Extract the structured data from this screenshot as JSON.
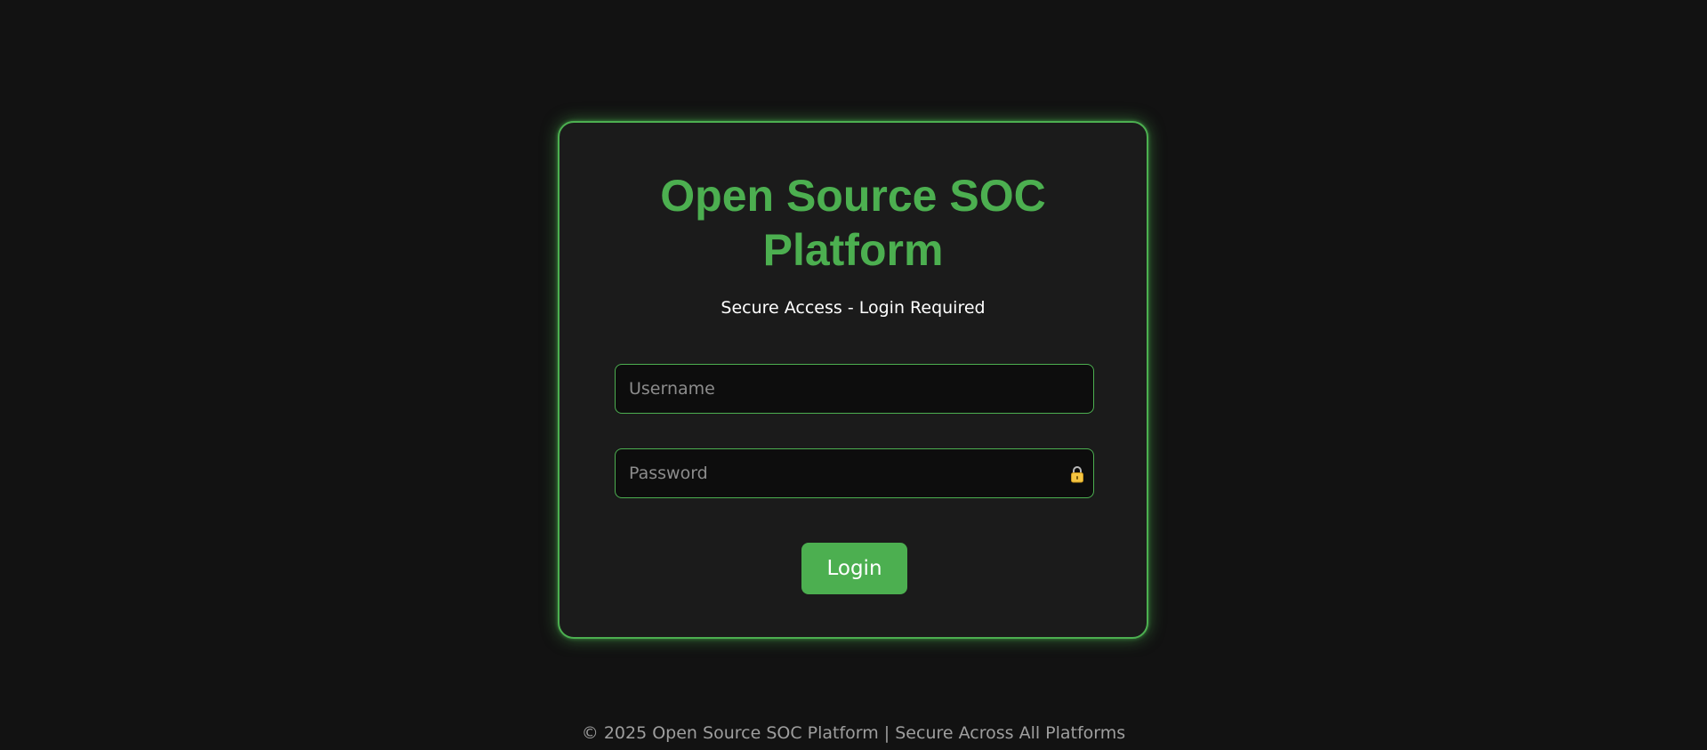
{
  "login": {
    "title": "Open Source SOC Platform",
    "subtitle": "Secure Access - Login Required",
    "username_placeholder": "Username",
    "password_placeholder": "Password",
    "password_icon": "lock-icon",
    "button_label": "Login"
  },
  "footer": {
    "text": "© 2025 Open Source SOC Platform | Secure Across All Platforms"
  },
  "colors": {
    "accent": "#4caf50",
    "background": "#121212",
    "card_background": "#1b1b1b",
    "lock_icon": "#f5c542"
  }
}
